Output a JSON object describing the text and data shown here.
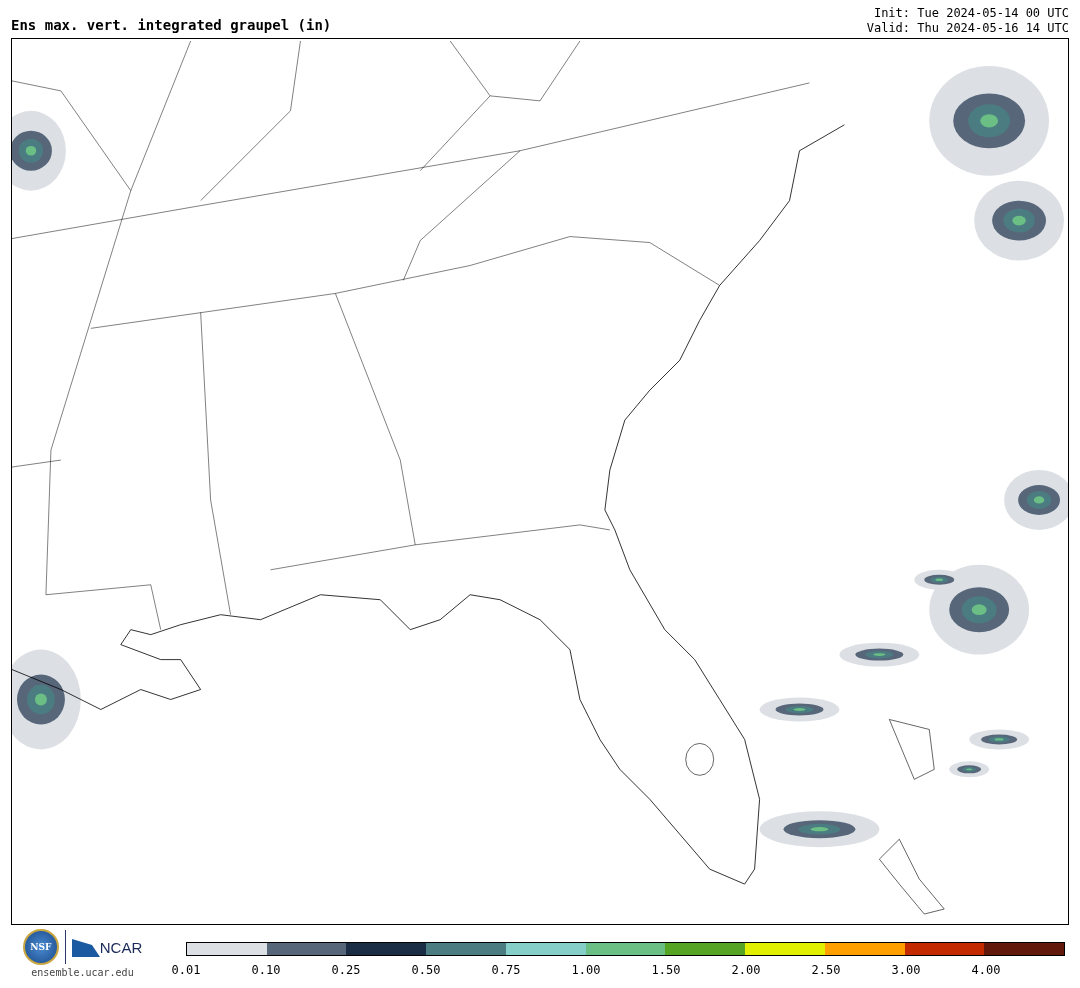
{
  "title": "Ens max. vert. integrated graupel (in)",
  "init": "Init: Tue 2024-05-14 00 UTC",
  "valid": "Valid: Thu 2024-05-16 14 UTC",
  "logos": {
    "ncar": "NCAR",
    "nsf": "NSF",
    "url": "ensemble.ucar.edu"
  },
  "colorbar": {
    "bins": [
      {
        "color": "#dce0e4"
      },
      {
        "color": "#58667a"
      },
      {
        "color": "#1a2d45"
      },
      {
        "color": "#4b7c82"
      },
      {
        "color": "#86cfc8"
      },
      {
        "color": "#6bbf84"
      },
      {
        "color": "#55a424"
      },
      {
        "color": "#e0f000"
      },
      {
        "color": "#ffa000"
      },
      {
        "color": "#c42a00"
      },
      {
        "color": "#62180a"
      }
    ],
    "ticks": [
      "0.01",
      "0.10",
      "0.25",
      "0.50",
      "0.75",
      "1.00",
      "1.50",
      "2.00",
      "2.50",
      "3.00",
      "4.00"
    ]
  }
}
